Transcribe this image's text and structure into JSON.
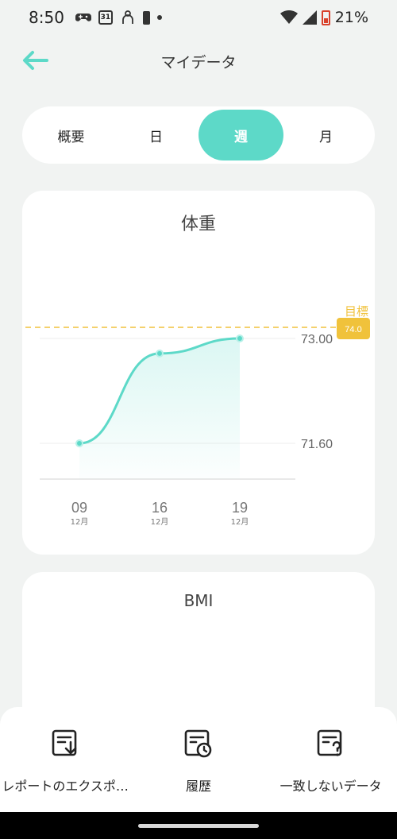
{
  "status_bar": {
    "time": "8:50",
    "calendar_day": "31",
    "battery_percent": "21%"
  },
  "app_bar": {
    "title": "マイデータ"
  },
  "segment_tabs": [
    {
      "label": "概要",
      "active": false
    },
    {
      "label": "日",
      "active": false
    },
    {
      "label": "週",
      "active": true
    },
    {
      "label": "月",
      "active": false
    }
  ],
  "weight_card": {
    "title": "体重"
  },
  "chart_data": {
    "type": "line",
    "title": "体重",
    "x": [
      "09",
      "16",
      "19"
    ],
    "x_sublabels": [
      "12月",
      "12月",
      "12月"
    ],
    "values": [
      71.6,
      72.8,
      73.0
    ],
    "y_ticks": [
      "73.00",
      "71.60"
    ],
    "goal": {
      "label": "目標",
      "value": 74.0,
      "badge": "74.0",
      "color": "#f0c23b"
    },
    "line_color": "#5dd9c8",
    "grid": true
  },
  "bmi_card": {
    "title": "BMI"
  },
  "bottom_actions": [
    {
      "label": "レポートのエクスポート",
      "icon": "export-report-icon"
    },
    {
      "label": "履歴",
      "icon": "history-icon"
    },
    {
      "label": "一致しないデータ",
      "icon": "unmatched-data-icon"
    }
  ],
  "colors": {
    "accent": "#5dd9c8",
    "goal": "#f0c23b",
    "background": "#f1f3f2"
  }
}
